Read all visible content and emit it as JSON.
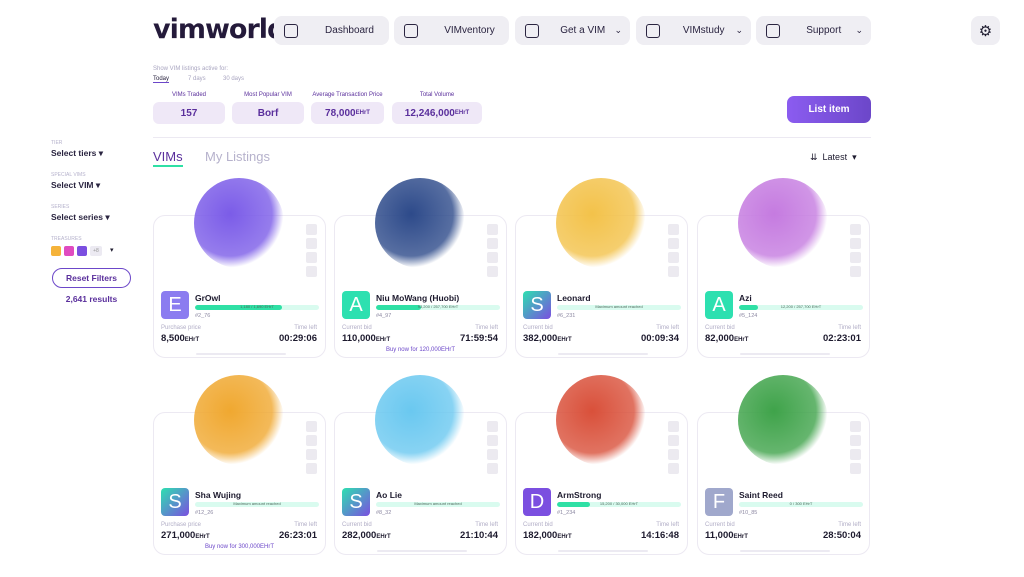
{
  "header": {
    "logo": "vimworld",
    "nav": [
      {
        "label": "Dashboard",
        "icon": "home-icon",
        "dropdown": false
      },
      {
        "label": "VIMventory",
        "icon": "bag-icon",
        "dropdown": false
      },
      {
        "label": "Get a VIM",
        "icon": "bell-icon",
        "dropdown": true
      },
      {
        "label": "VIMstudy",
        "icon": "book-icon",
        "dropdown": true
      },
      {
        "label": "Support",
        "icon": "chat-icon",
        "dropdown": true
      }
    ],
    "settings_icon": "gear-icon"
  },
  "filters": {
    "period_label": "Show VIM listings active for:",
    "periods": [
      "Today",
      "7 days",
      "30 days"
    ],
    "active_period": "Today"
  },
  "stats": [
    {
      "label": "VIMs Traded",
      "value": "157",
      "unit": ""
    },
    {
      "label": "Most Popular VIM",
      "value": "Borf",
      "unit": ""
    },
    {
      "label": "Average Transaction Price",
      "value": "78,000",
      "unit": "EHrT"
    },
    {
      "label": "Total Volume",
      "value": "12,246,000",
      "unit": "EHrT"
    }
  ],
  "list_item": "List item",
  "tabs": {
    "vims": "VIMs",
    "my_listings": "My Listings",
    "active": "VIMs"
  },
  "sort": "Latest",
  "sidebar": {
    "tier_label": "TIER",
    "tier": "Select tiers",
    "special_label": "SPECIAL VIMs",
    "special": "Select VIM",
    "series_label": "SERIES",
    "series": "Select series",
    "treasures_label": "TREASURES",
    "treasures_more": "+8",
    "reset": "Reset Filters",
    "results": "2,641 results"
  },
  "cards": [
    {
      "name": "GrOwl",
      "letter": "E",
      "avatar": "#8b7cf0",
      "id": "#2_76",
      "bar_text": "1,180 / 1,690 EHrT",
      "fill": 0.7,
      "price_label": "Purchase price",
      "price": "8,500",
      "time_label": "Time left",
      "time": "00:29:06",
      "buy": "",
      "art": "#7b5ce8"
    },
    {
      "name": "Niu MoWang (Huobi)",
      "letter": "A",
      "avatar": "#2de0b0",
      "id": "#4_97",
      "bar_text": "93,200 / 257,700 EHrT",
      "fill": 0.36,
      "price_label": "Current bid",
      "price": "110,000",
      "time_label": "Time left",
      "time": "71:59:54",
      "buy": "Buy now for 120,000EHrT",
      "art": "#2d4a8a"
    },
    {
      "name": "Leonard",
      "letter": "S",
      "avatar": "linear-gradient(135deg,#2de0b0,#7b4fe0)",
      "id": "#6_231",
      "bar_text": "Maximum amount reached",
      "fill": 0,
      "price_label": "Current bid",
      "price": "382,000",
      "time_label": "Time left",
      "time": "00:09:34",
      "buy": "",
      "art": "#f3c24a"
    },
    {
      "name": "Azi",
      "letter": "A",
      "avatar": "#2de0b0",
      "id": "#5_124",
      "bar_text": "12,200 / 257,700 EHrT",
      "fill": 0.15,
      "price_label": "Current bid",
      "price": "82,000",
      "time_label": "Time left",
      "time": "02:23:01",
      "buy": "",
      "art": "#c57be0"
    },
    {
      "name": "Sha Wujing",
      "letter": "S",
      "avatar": "linear-gradient(135deg,#2de0b0,#7b4fe0)",
      "id": "#12_26",
      "bar_text": "Maximum amount reached",
      "fill": 0,
      "price_label": "Purchase price",
      "price": "271,000",
      "time_label": "Time left",
      "time": "26:23:01",
      "buy": "Buy now for 300,000EHrT",
      "art": "#f0a830"
    },
    {
      "name": "Ao Lie",
      "letter": "S",
      "avatar": "linear-gradient(135deg,#2de0b0,#7b4fe0)",
      "id": "#8_32",
      "bar_text": "Maximum amount reached",
      "fill": 0,
      "price_label": "Current bid",
      "price": "282,000",
      "time_label": "Time left",
      "time": "21:10:44",
      "buy": "",
      "art": "#6ac8f0"
    },
    {
      "name": "ArmStrong",
      "letter": "D",
      "avatar": "#7b4fe0",
      "id": "#1_234",
      "bar_text": "15,200 / 30,000 EHrT",
      "fill": 0.27,
      "price_label": "Current bid",
      "price": "182,000",
      "time_label": "Time left",
      "time": "14:16:48",
      "buy": "",
      "art": "#d9503a"
    },
    {
      "name": "Saint Reed",
      "letter": "F",
      "avatar": "#a0a8cc",
      "id": "#10_85",
      "bar_text": "0 / 300 EHrT",
      "fill": 0,
      "price_label": "Current bid",
      "price": "11,000",
      "time_label": "Time left",
      "time": "28:50:04",
      "buy": "",
      "art": "#3fa34a"
    }
  ],
  "currency": "EHrT"
}
